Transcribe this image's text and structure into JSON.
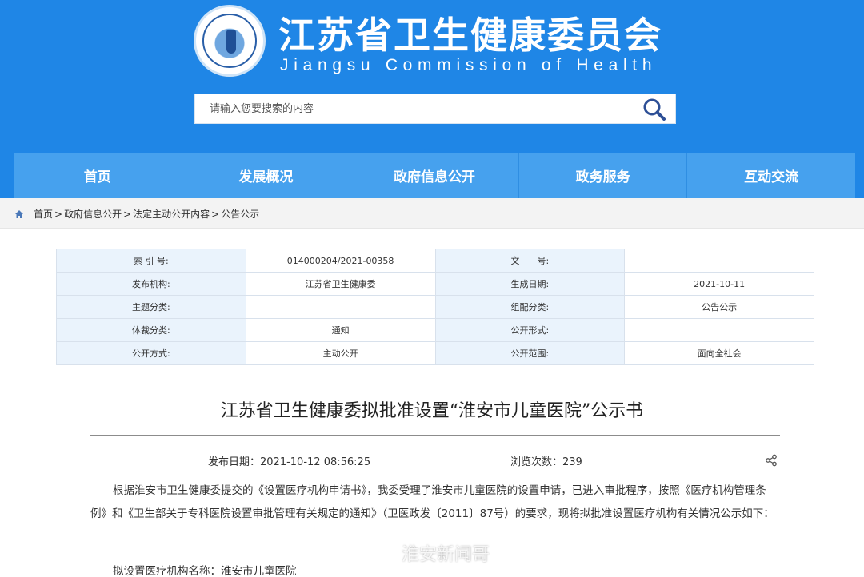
{
  "header": {
    "title": "江苏省卫生健康委员会",
    "subtitle": "Jiangsu Commission of Health",
    "logo_text": "Jiangsu Commission of Health"
  },
  "search": {
    "placeholder": "请输入您要搜索的内容",
    "icon": "search-icon"
  },
  "nav": {
    "items": [
      "首页",
      "发展概况",
      "政府信息公开",
      "政务服务",
      "互动交流"
    ]
  },
  "breadcrumb": {
    "items": [
      "首页",
      "政府信息公开",
      "法定主动公开内容",
      "公告公示"
    ],
    "separator": ">"
  },
  "meta": {
    "rows": [
      [
        "索 引 号:",
        "014000204/2021-00358",
        "文　　号:",
        ""
      ],
      [
        "发布机构:",
        "江苏省卫生健康委",
        "生成日期:",
        "2021-10-11"
      ],
      [
        "主题分类:",
        "",
        "组配分类:",
        "公告公示"
      ],
      [
        "体裁分类:",
        "通知",
        "公开形式:",
        ""
      ],
      [
        "公开方式:",
        "主动公开",
        "公开范围:",
        "面向全社会"
      ]
    ]
  },
  "article": {
    "title": "江苏省卫生健康委拟批准设置“淮安市儿童医院”公示书",
    "publish_label": "发布日期：",
    "publish_date": "2021-10-12 08:56:25",
    "views_label": "浏览次数：",
    "views": "239",
    "body": "根据淮安市卫生健康委提交的《设置医疗机构申请书》，我委受理了淮安市儿童医院的设置申请，已进入审批程序，按照《医疗机构管理条例》和《卫生部关于专科医院设置审批管理有关规定的通知》（卫医政发〔2011〕87号）的要求，现将拟批准设置医疗机构有关情况公示如下：",
    "item1": "拟设置医疗机构名称：淮安市儿童医院"
  },
  "watermark": {
    "text": "淮安新闻哥"
  },
  "colors": {
    "header_bg": "#1f86e6",
    "nav_bg": "#46a1ee",
    "meta_key_bg": "#eaf3fc"
  }
}
